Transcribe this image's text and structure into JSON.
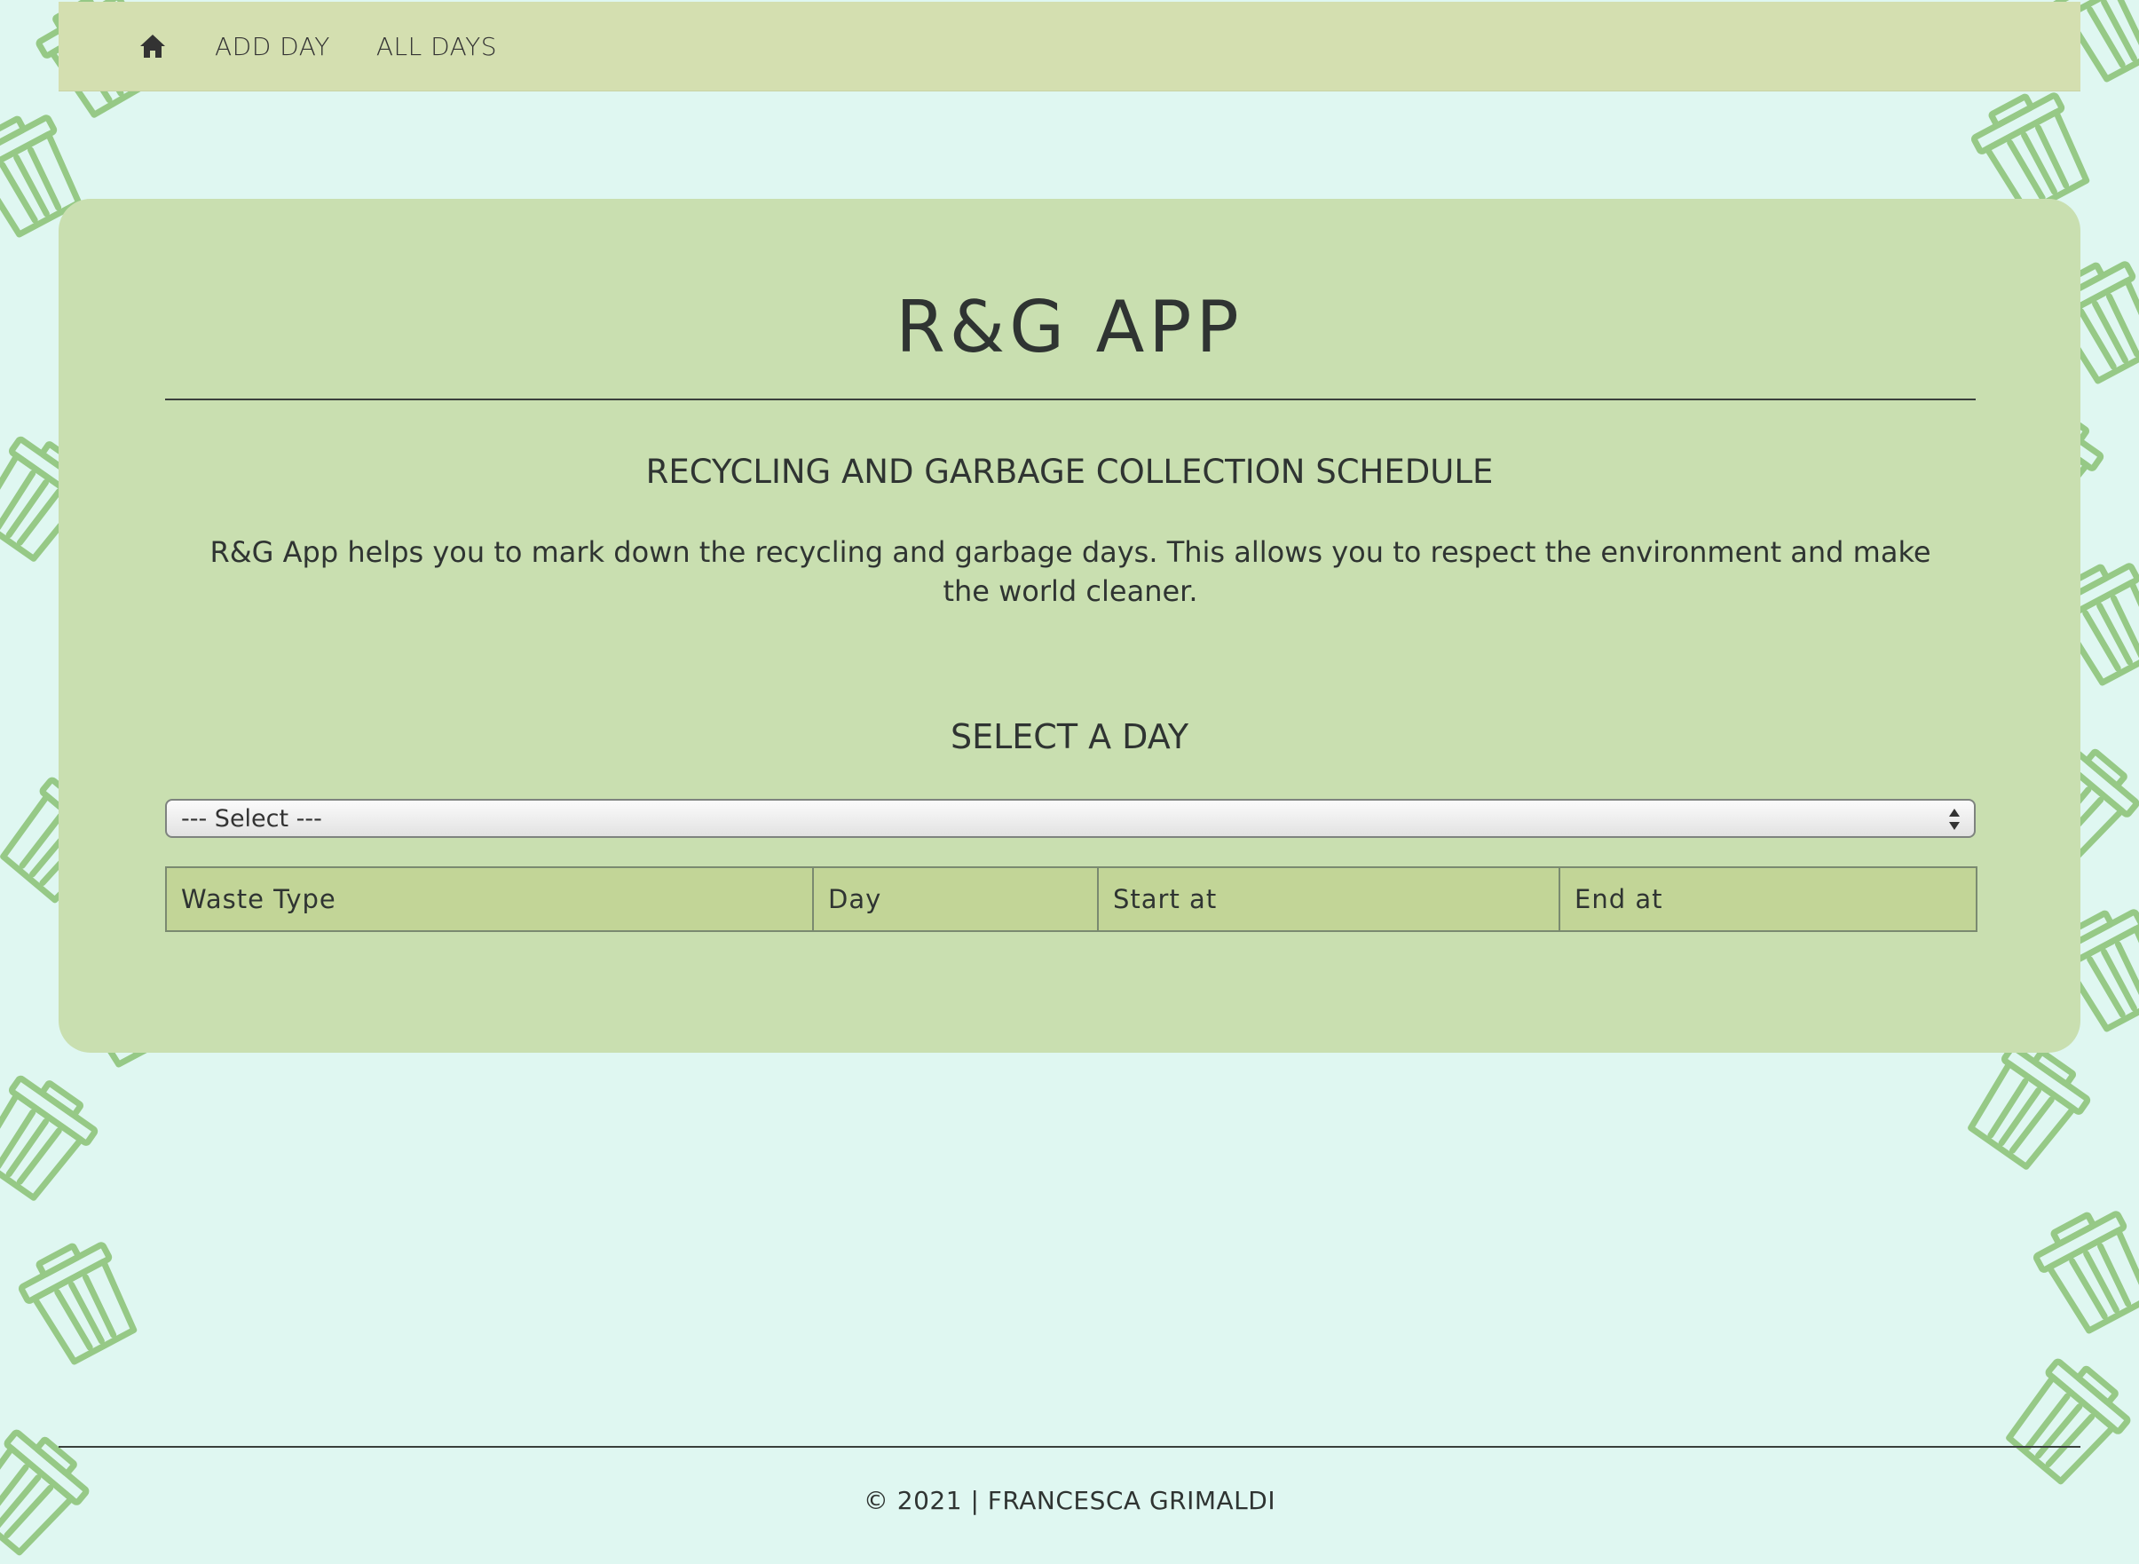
{
  "nav": {
    "home_icon": "home-icon",
    "links": [
      "ADD DAY",
      "ALL DAYS"
    ]
  },
  "main": {
    "title": "R&G APP",
    "subtitle": "RECYCLING AND GARBAGE COLLECTION SCHEDULE",
    "intro": "R&G App helps you to mark down the recycling and garbage days. This allows you to respect the environment and make the world cleaner.",
    "select_heading": "SELECT A DAY",
    "select": {
      "selected": "--- Select ---"
    }
  },
  "table": {
    "headers": [
      "Waste Type",
      "Day",
      "Start at",
      "End at"
    ]
  },
  "footer": {
    "text": "© 2021 | FRANCESCA GRIMALDI"
  },
  "colors": {
    "background": "#dff7f1",
    "navbar": "#d4dfb0",
    "card": "#c9dfb0",
    "table_header": "#c2d597",
    "bin_icon": "#86bf6e"
  }
}
